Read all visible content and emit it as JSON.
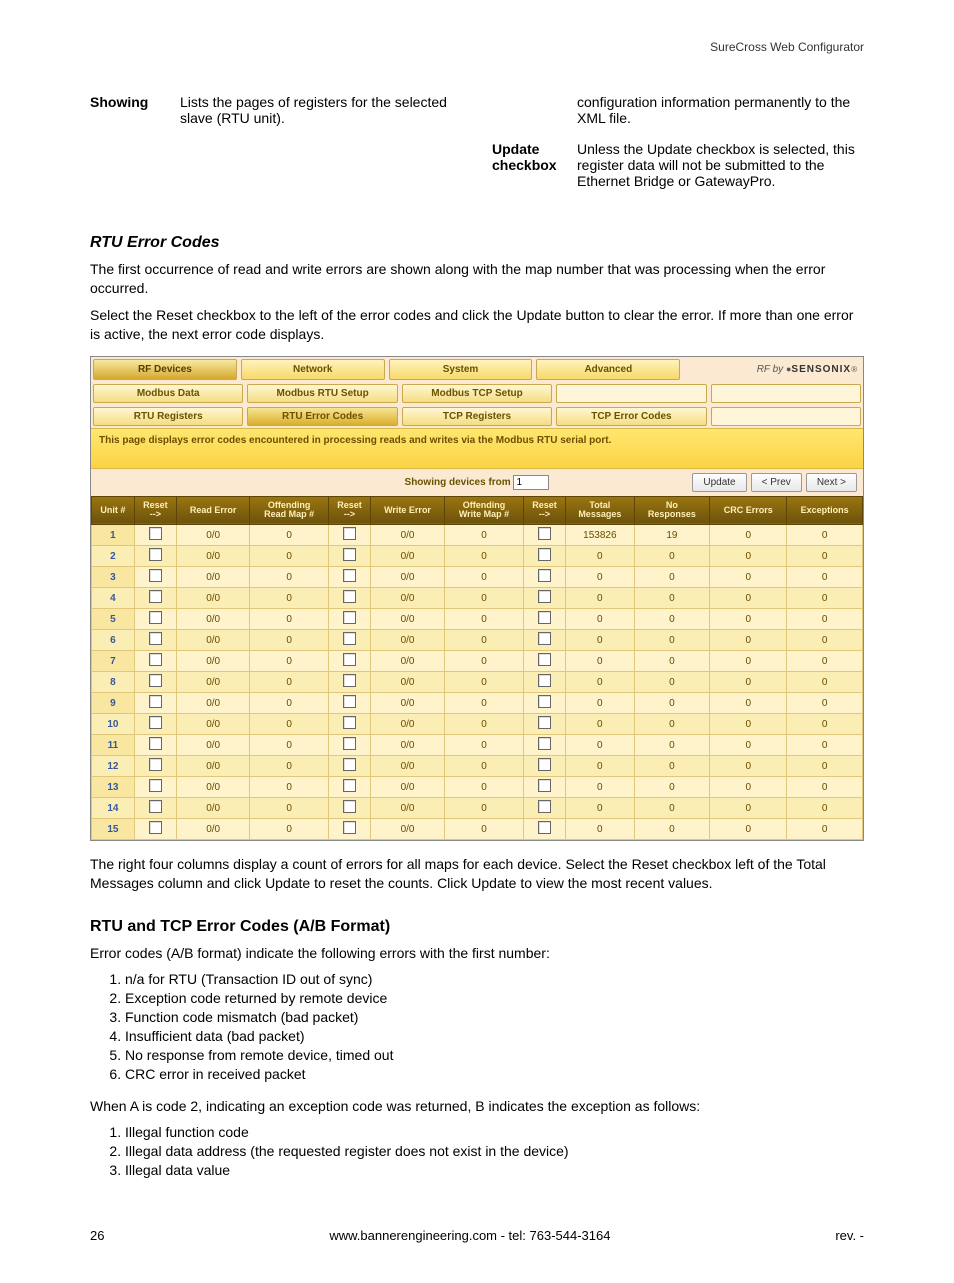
{
  "header": {
    "title": "SureCross Web Configurator"
  },
  "defs": {
    "left": {
      "term": "Showing",
      "desc": "Lists the pages of registers for the selected slave (RTU unit)."
    },
    "right": [
      {
        "term": "",
        "desc": "configuration information permanently to the XML file."
      },
      {
        "term": "Update checkbox",
        "desc": "Unless the Update checkbox is selected, this register data will not be submitted to the Ethernet Bridge or GatewayPro."
      }
    ]
  },
  "rtu": {
    "title": "RTU Error Codes",
    "p1": "The first occurrence of read and write errors are shown along with the map number that was processing when the error occurred.",
    "p2": "Select the Reset checkbox to the left of the error codes and click the Update button to clear the error. If more than one error is active, the next error code displays."
  },
  "app": {
    "nav": [
      "RF Devices",
      "Network",
      "System",
      "Advanced"
    ],
    "rfby_label": "RF by ",
    "rfby_brand": "SENSONIX",
    "sub1": [
      "Modbus Data",
      "Modbus RTU Setup",
      "Modbus TCP Setup",
      ""
    ],
    "sub2": [
      "RTU Registers",
      "RTU Error Codes",
      "TCP Registers",
      "TCP Error Codes",
      ""
    ],
    "pagenote": "This page displays error codes encountered in processing reads and writes via the Modbus RTU serial port.",
    "showing_label": "Showing devices from",
    "showing_value": "1",
    "update": "Update",
    "prev": "< Prev",
    "next": "Next >",
    "headers": [
      "Unit #",
      "Reset -->",
      "Read Error",
      "Offending Read Map #",
      "Reset -->",
      "Write Error",
      "Offending Write Map #",
      "Reset -->",
      "Total Messages",
      "No Responses",
      "CRC Errors",
      "Exceptions"
    ],
    "rows": [
      {
        "u": "1",
        "re": "0/0",
        "orm": "0",
        "we": "0/0",
        "owm": "0",
        "tm": "153826",
        "nr": "19",
        "crc": "0",
        "ex": "0"
      },
      {
        "u": "2",
        "re": "0/0",
        "orm": "0",
        "we": "0/0",
        "owm": "0",
        "tm": "0",
        "nr": "0",
        "crc": "0",
        "ex": "0"
      },
      {
        "u": "3",
        "re": "0/0",
        "orm": "0",
        "we": "0/0",
        "owm": "0",
        "tm": "0",
        "nr": "0",
        "crc": "0",
        "ex": "0"
      },
      {
        "u": "4",
        "re": "0/0",
        "orm": "0",
        "we": "0/0",
        "owm": "0",
        "tm": "0",
        "nr": "0",
        "crc": "0",
        "ex": "0"
      },
      {
        "u": "5",
        "re": "0/0",
        "orm": "0",
        "we": "0/0",
        "owm": "0",
        "tm": "0",
        "nr": "0",
        "crc": "0",
        "ex": "0"
      },
      {
        "u": "6",
        "re": "0/0",
        "orm": "0",
        "we": "0/0",
        "owm": "0",
        "tm": "0",
        "nr": "0",
        "crc": "0",
        "ex": "0"
      },
      {
        "u": "7",
        "re": "0/0",
        "orm": "0",
        "we": "0/0",
        "owm": "0",
        "tm": "0",
        "nr": "0",
        "crc": "0",
        "ex": "0"
      },
      {
        "u": "8",
        "re": "0/0",
        "orm": "0",
        "we": "0/0",
        "owm": "0",
        "tm": "0",
        "nr": "0",
        "crc": "0",
        "ex": "0"
      },
      {
        "u": "9",
        "re": "0/0",
        "orm": "0",
        "we": "0/0",
        "owm": "0",
        "tm": "0",
        "nr": "0",
        "crc": "0",
        "ex": "0"
      },
      {
        "u": "10",
        "re": "0/0",
        "orm": "0",
        "we": "0/0",
        "owm": "0",
        "tm": "0",
        "nr": "0",
        "crc": "0",
        "ex": "0"
      },
      {
        "u": "11",
        "re": "0/0",
        "orm": "0",
        "we": "0/0",
        "owm": "0",
        "tm": "0",
        "nr": "0",
        "crc": "0",
        "ex": "0"
      },
      {
        "u": "12",
        "re": "0/0",
        "orm": "0",
        "we": "0/0",
        "owm": "0",
        "tm": "0",
        "nr": "0",
        "crc": "0",
        "ex": "0"
      },
      {
        "u": "13",
        "re": "0/0",
        "orm": "0",
        "we": "0/0",
        "owm": "0",
        "tm": "0",
        "nr": "0",
        "crc": "0",
        "ex": "0"
      },
      {
        "u": "14",
        "re": "0/0",
        "orm": "0",
        "we": "0/0",
        "owm": "0",
        "tm": "0",
        "nr": "0",
        "crc": "0",
        "ex": "0"
      },
      {
        "u": "15",
        "re": "0/0",
        "orm": "0",
        "we": "0/0",
        "owm": "0",
        "tm": "0",
        "nr": "0",
        "crc": "0",
        "ex": "0"
      }
    ]
  },
  "post_table": "The right four columns display a count of errors for all maps for each device. Select the Reset checkbox left of the Total Messages column and click Update to reset the counts. Click Update to view the most recent values.",
  "codes": {
    "title": "RTU and TCP Error Codes (A/B Format)",
    "intro": "Error codes (A/B format) indicate the following errors with the first number:",
    "list1": [
      "n/a for RTU (Transaction ID out of sync)",
      "Exception code returned by remote device",
      "Function code mismatch (bad packet)",
      "Insufficient data (bad packet)",
      "No response from remote device, timed out",
      "CRC error in received packet"
    ],
    "mid": "When A is code 2, indicating an exception code was returned, B indicates the exception as follows:",
    "list2": [
      "Illegal function code",
      "Illegal data address (the requested register does not exist in the device)",
      "Illegal data value"
    ]
  },
  "footer": {
    "page": "26",
    "center": "www.bannerengineering.com - tel: 763-544-3164",
    "right": "rev. -"
  }
}
